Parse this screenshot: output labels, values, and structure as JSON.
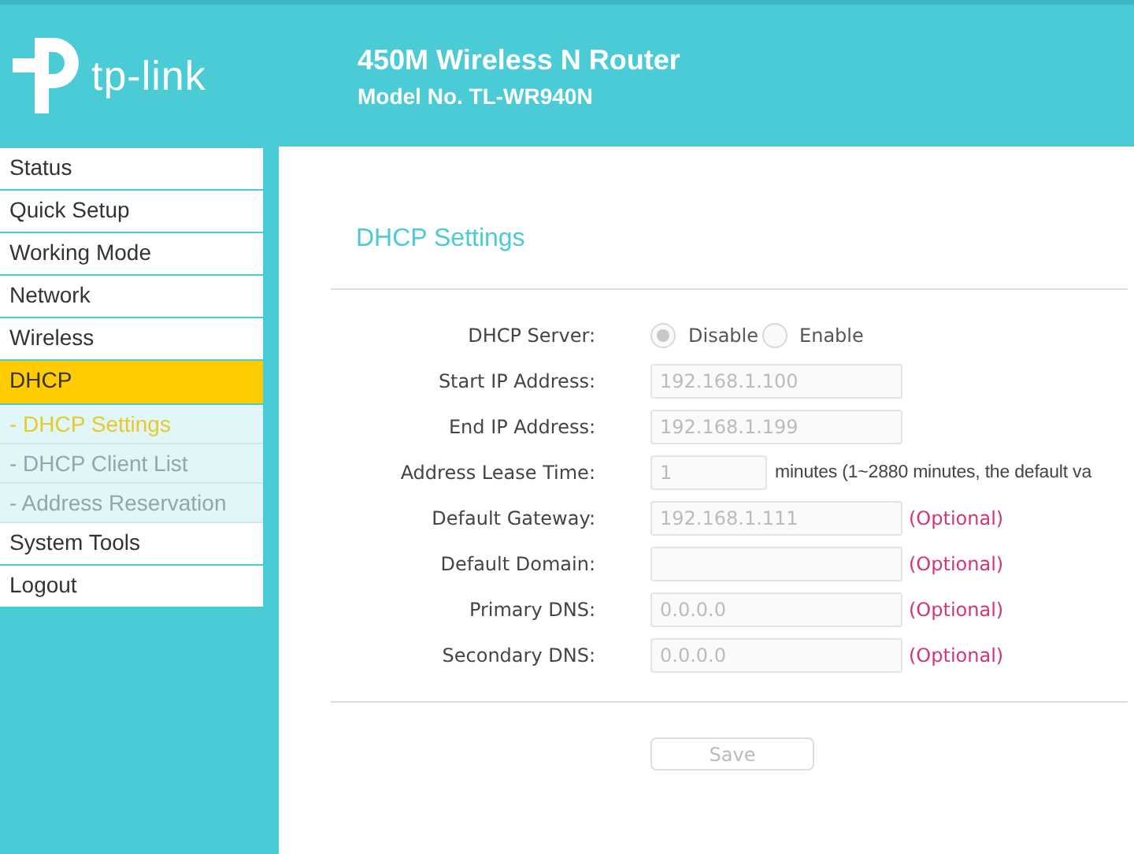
{
  "header": {
    "logo_text": "tp-link",
    "title": "450M Wireless N Router",
    "model": "Model No. TL-WR940N"
  },
  "menu": [
    {
      "label": "Status",
      "kind": "main",
      "selected": false
    },
    {
      "label": "Quick Setup",
      "kind": "main",
      "selected": false
    },
    {
      "label": "Working Mode",
      "kind": "main",
      "selected": false
    },
    {
      "label": "Network",
      "kind": "main",
      "selected": false
    },
    {
      "label": "Wireless",
      "kind": "main",
      "selected": false
    },
    {
      "label": "DHCP",
      "kind": "main",
      "selected": true
    },
    {
      "label": "- DHCP Settings",
      "kind": "sub",
      "selected": true
    },
    {
      "label": "- DHCP Client List",
      "kind": "sub",
      "selected": false
    },
    {
      "label": "- Address Reservation",
      "kind": "sub",
      "selected": false
    },
    {
      "label": "System Tools",
      "kind": "main",
      "selected": false
    },
    {
      "label": "Logout",
      "kind": "main",
      "selected": false
    }
  ],
  "page_title": "DHCP Settings",
  "fields": [
    {
      "kind": "radio",
      "label": "DHCP Server:",
      "options": [
        {
          "label": "Disable",
          "selected": true,
          "disabled": true
        },
        {
          "label": "Enable",
          "selected": false,
          "disabled": true
        }
      ]
    },
    {
      "kind": "text",
      "label": "Start IP Address:",
      "value": "192.168.1.100",
      "disabled": true
    },
    {
      "kind": "text",
      "label": "End IP Address:",
      "value": "192.168.1.199",
      "disabled": true
    },
    {
      "kind": "short",
      "label": "Address Lease Time:",
      "value": "1",
      "disabled": true,
      "note": "minutes (1~2880 minutes, the default va"
    },
    {
      "kind": "text",
      "label": "Default Gateway:",
      "value": "192.168.1.111",
      "disabled": true,
      "optional": "(Optional)"
    },
    {
      "kind": "text",
      "label": "Default Domain:",
      "disabled": true,
      "optional": "(Optional)"
    },
    {
      "kind": "text",
      "label": "Primary DNS:",
      "value": "0.0.0.0",
      "disabled": true,
      "optional": "(Optional)"
    },
    {
      "kind": "text",
      "label": "Secondary DNS:",
      "value": "0.0.0.0",
      "disabled": true,
      "optional": "(Optional)"
    }
  ],
  "save": {
    "label": "Save",
    "disabled": true
  }
}
